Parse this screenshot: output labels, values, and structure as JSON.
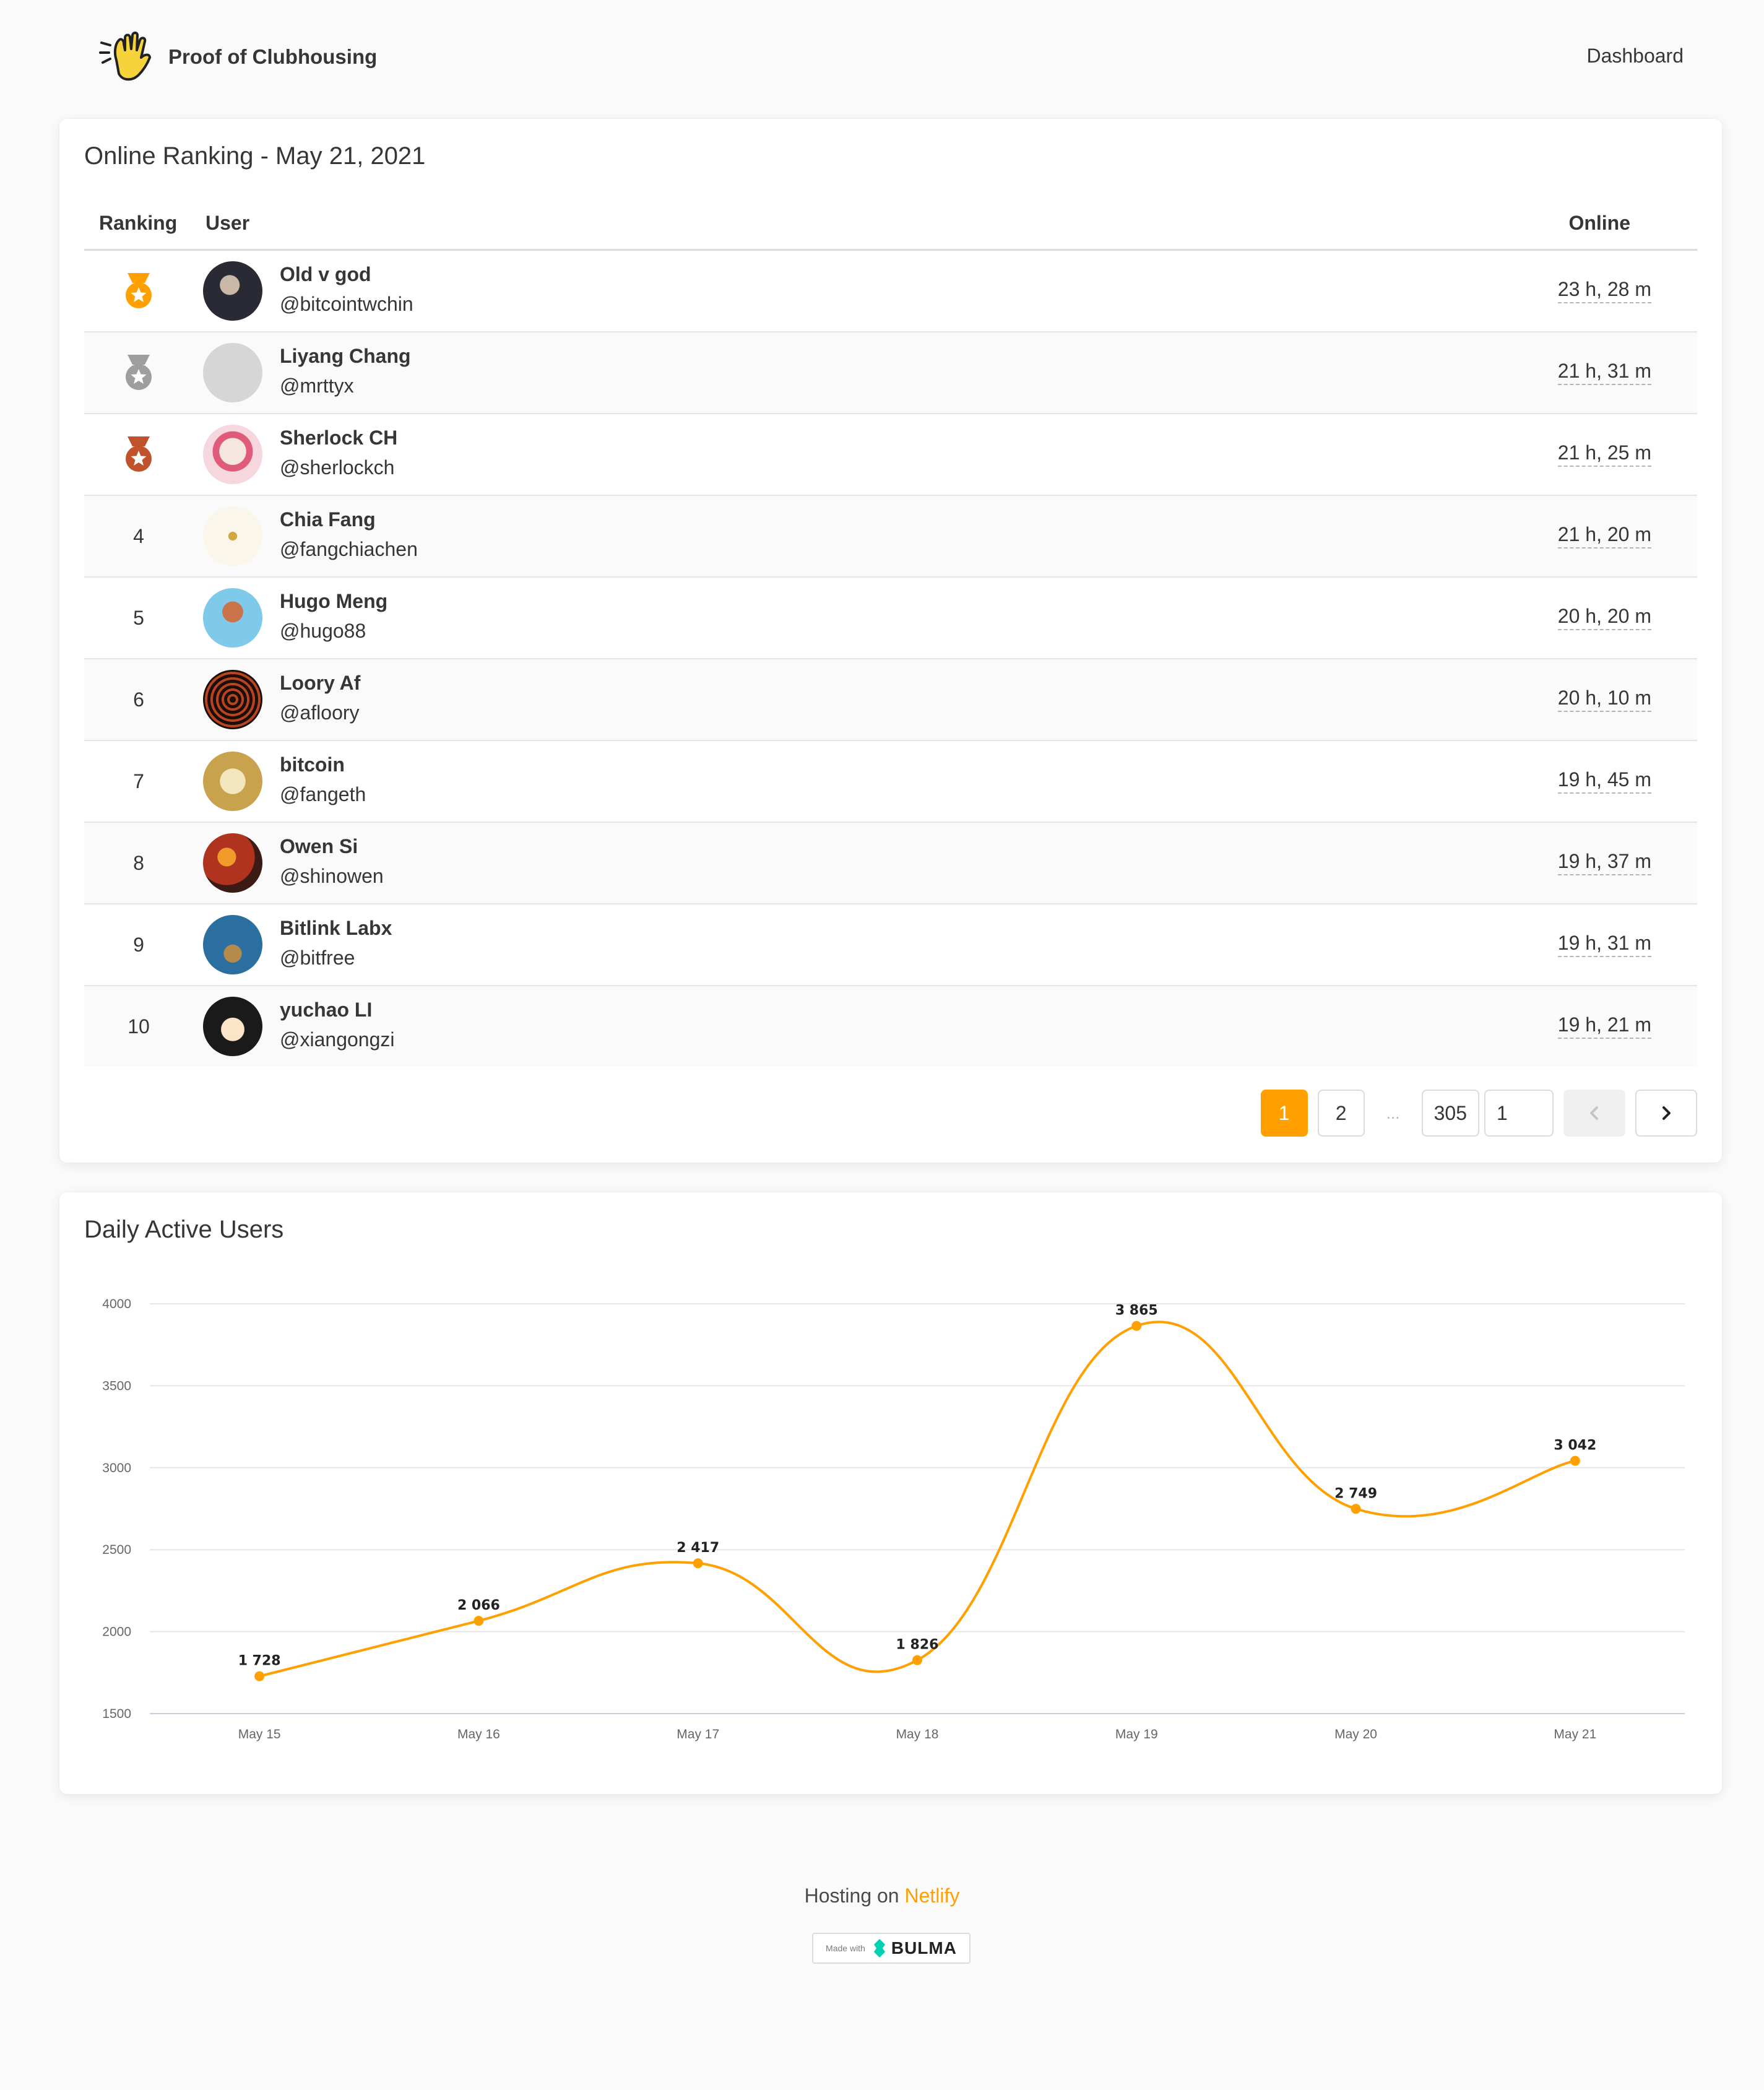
{
  "brand": {
    "title": "Proof of Clubhousing"
  },
  "nav": {
    "dashboard": "Dashboard"
  },
  "ranking": {
    "title": "Online Ranking - May 21, 2021",
    "columns": {
      "ranking": "Ranking",
      "user": "User",
      "online": "Online"
    },
    "rows": [
      {
        "rank": "",
        "medal": "gold",
        "name": "Old v god",
        "handle": "@bitcointwchin",
        "online": "23 h, 28 m"
      },
      {
        "rank": "",
        "medal": "silver",
        "name": "Liyang Chang",
        "handle": "@mrttyx",
        "online": "21 h, 31 m"
      },
      {
        "rank": "",
        "medal": "bronze",
        "name": "Sherlock CH",
        "handle": "@sherlockch",
        "online": "21 h, 25 m"
      },
      {
        "rank": "4",
        "name": "Chia Fang",
        "handle": "@fangchiachen",
        "online": "21 h, 20 m"
      },
      {
        "rank": "5",
        "name": "Hugo Meng",
        "handle": "@hugo88",
        "online": "20 h, 20 m"
      },
      {
        "rank": "6",
        "name": "Loory Af",
        "handle": "@afloory",
        "online": "20 h, 10 m"
      },
      {
        "rank": "7",
        "name": "bitcoin",
        "handle": "@fangeth",
        "online": "19 h, 45 m"
      },
      {
        "rank": "8",
        "name": "Owen Si",
        "handle": "@shinowen",
        "online": "19 h, 37 m"
      },
      {
        "rank": "9",
        "name": "Bitlink Labx",
        "handle": "@bitfree",
        "online": "19 h, 31 m"
      },
      {
        "rank": "10",
        "name": "yuchao LI",
        "handle": "@xiangongzi",
        "online": "19 h, 21 m"
      }
    ]
  },
  "pagination": {
    "pages": [
      "1",
      "2"
    ],
    "current": "1",
    "ellipsis": "...",
    "last": "305",
    "input_value": "1",
    "prev_icon": "chevron-left-icon",
    "next_icon": "chevron-right-icon"
  },
  "dau": {
    "title": "Daily Active Users"
  },
  "chart_data": {
    "type": "line",
    "title": "Daily Active Users",
    "categories": [
      "May 15",
      "May 16",
      "May 17",
      "May 18",
      "May 19",
      "May 20",
      "May 21"
    ],
    "series": [
      {
        "values": [
          1728,
          2066,
          2417,
          1826,
          3865,
          2749,
          3042
        ],
        "labels": [
          "1 728",
          "2 066",
          "2 417",
          "1 826",
          "3 865",
          "2 749",
          "3 042"
        ]
      }
    ],
    "yticks": [
      "4000",
      "3500",
      "3000",
      "2500",
      "2000",
      "1500"
    ],
    "ylim": [
      1500,
      4000
    ],
    "color": "#ff9f00",
    "grid": true,
    "curve": "smooth"
  },
  "footer": {
    "hosting_prefix": "Hosting on ",
    "hosting_link": "Netlify",
    "made_with": "Made with",
    "bulma": "BULMA"
  },
  "colors": {
    "accent": "#ff9f00",
    "gold": "#ff9f00",
    "silver": "#9e9e9e",
    "bronze": "#c0532b"
  }
}
